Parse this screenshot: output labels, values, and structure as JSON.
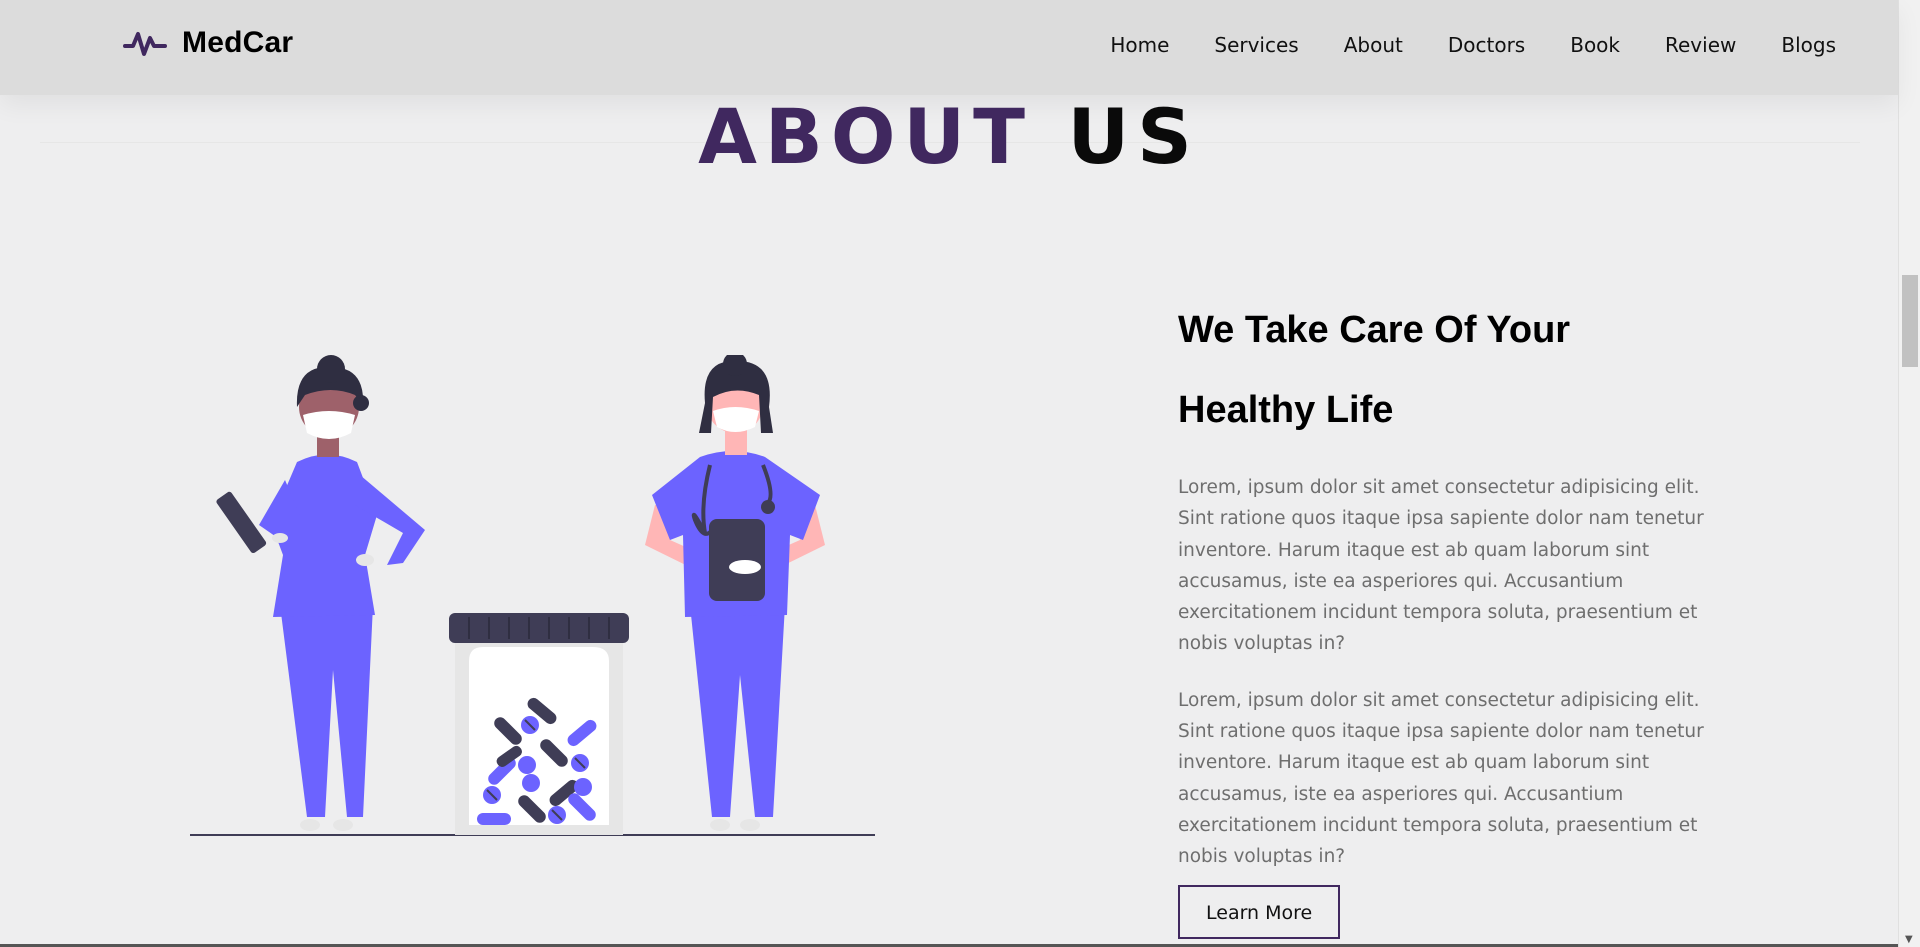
{
  "brand": {
    "name": "MedCar",
    "icon": "pulse-icon",
    "color": "#40285f"
  },
  "nav": {
    "items": [
      "Home",
      "Services",
      "About",
      "Doctors",
      "Book",
      "Review",
      "Blogs"
    ]
  },
  "section_title": {
    "accent": "ABOUT",
    "rest": "US"
  },
  "about": {
    "heading_line1": "We Take Care Of Your",
    "heading_line2": "Healthy Life",
    "paragraph1": "Lorem, ipsum dolor sit amet consectetur adipisicing elit. Sint ratione quos itaque ipsa sapiente dolor nam tenetur inventore. Harum itaque est ab quam laborum sint accusamus, iste ea asperiores qui. Accusantium exercitationem incidunt tempora soluta, praesentium et nobis voluptas in?",
    "paragraph2": "Lorem, ipsum dolor sit amet consectetur adipisicing elit. Sint ratione quos itaque ipsa sapiente dolor nam tenetur inventore. Harum itaque est ab quam laborum sint accusamus, iste ea asperiores qui. Accusantium exercitationem incidunt tempora soluta, praesentium et nobis voluptas in?",
    "button_label": "Learn More"
  },
  "colors": {
    "scrub": "#6c63ff",
    "dark": "#3f3d56",
    "accent": "#40285f"
  }
}
